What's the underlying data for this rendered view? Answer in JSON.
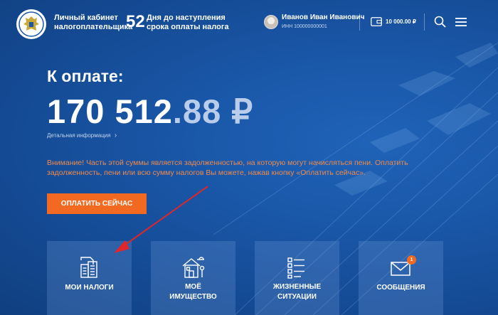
{
  "header": {
    "brand_line1": "Личный кабинет",
    "brand_line2": "налогоплательщика",
    "days_count": "52",
    "days_line1": "Дня до наступления",
    "days_line2": "срока оплаты налога",
    "user_name": "Иванов Иван Иванович",
    "user_inn": "ИНН 100000000001",
    "balance": "10 000.00 ₽"
  },
  "payment": {
    "label": "К оплате:",
    "amount_int": "170 512",
    "amount_frac": ".88 ₽",
    "details_link": "Детальная информация",
    "warning": "Внимание! Часть этой суммы является задолженностью, на которую могут начисляться пени. Оплатить задолженность, пени или всю сумму налогов Вы можете, нажав кнопку «Оплатить сейчас».",
    "pay_button": "ОПЛАТИТЬ СЕЙЧАС"
  },
  "tiles": [
    {
      "line1": "МОИ НАЛОГИ",
      "line2": "",
      "icon": "documents-icon"
    },
    {
      "line1": "МОЁ",
      "line2": "ИМУЩЕСТВО",
      "icon": "house-icon"
    },
    {
      "line1": "ЖИЗНЕННЫЕ",
      "line2": "СИТУАЦИИ",
      "icon": "checklist-icon"
    },
    {
      "line1": "СООБЩЕНИЯ",
      "line2": "",
      "icon": "envelope-icon",
      "badge": "1"
    }
  ],
  "colors": {
    "accent": "#f26a21",
    "warning_text": "#f08a4b",
    "background": "#1a57a8"
  }
}
